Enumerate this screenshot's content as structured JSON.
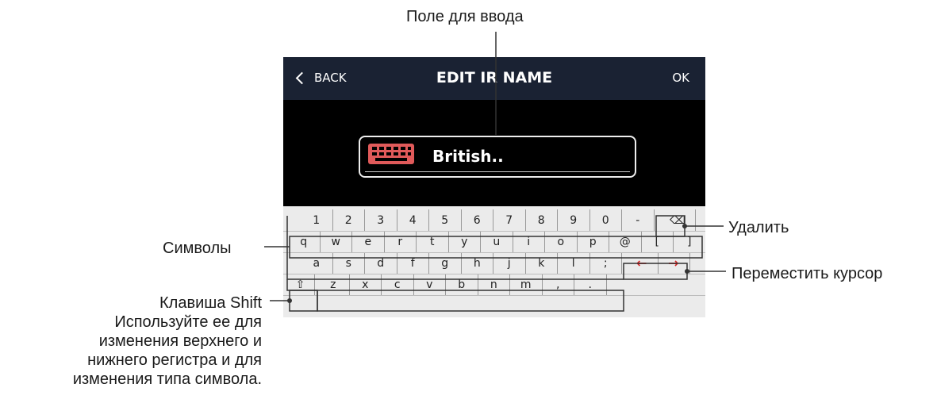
{
  "annotations": {
    "input_field": "Поле для ввода",
    "delete": "Удалить",
    "symbols": "Символы",
    "move_cursor": "Переместить курсор",
    "shift_key": "Клавиша Shift",
    "shift_desc_1": "Используйте ее для",
    "shift_desc_2": "изменения верхнего и",
    "shift_desc_3": "нижнего регистра и для",
    "shift_desc_4": "изменения типа символа."
  },
  "header": {
    "back_label": "BACK",
    "title": "EDIT IR NAME",
    "ok_label": "OK"
  },
  "input": {
    "value": "British.."
  },
  "keyboard": {
    "row1": [
      "1",
      "2",
      "3",
      "4",
      "5",
      "6",
      "7",
      "8",
      "9",
      "0",
      "-"
    ],
    "backspace": "⌫",
    "row2": [
      "q",
      "w",
      "e",
      "r",
      "t",
      "y",
      "u",
      "i",
      "o",
      "p",
      "@",
      "[",
      "]"
    ],
    "row3": [
      "a",
      "s",
      "d",
      "f",
      "g",
      "h",
      "j",
      "k",
      "l",
      ";"
    ],
    "cursor_left": "←",
    "cursor_right": "→",
    "shift": "⇧",
    "row4": [
      "z",
      "x",
      "c",
      "v",
      "b",
      "n",
      "m",
      ",",
      "."
    ]
  },
  "colors": {
    "header_bg": "#1a2233",
    "icon_red": "#e05a5a",
    "arrow_red": "#d62020"
  }
}
